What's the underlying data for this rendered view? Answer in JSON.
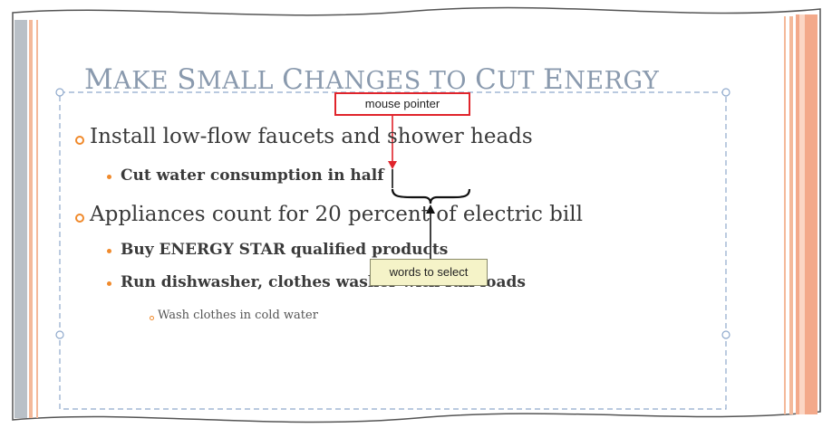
{
  "slide": {
    "title_parts": [
      {
        "cap": "M",
        "rest": "AKE "
      },
      {
        "cap": "S",
        "rest": "MALL "
      },
      {
        "cap": "C",
        "rest": "HANGES TO "
      },
      {
        "cap": "C",
        "rest": "UT "
      },
      {
        "cap": "E",
        "rest": "NERGY"
      }
    ],
    "bullet1": "Install low-flow faucets and shower heads",
    "bullet1_sub": "Cut water consumption in half",
    "bullet2": "Appliances count for 20 percent of electric bill",
    "bullet2_sub1": "Buy ENERGY STAR qualified products",
    "bullet2_sub2": "Run dishwasher, clothes washer with full loads",
    "bullet2_sub2_sub": "Wash clothes in cold water"
  },
  "callouts": {
    "mouse_pointer": "mouse pointer",
    "words_to_select": "words to select"
  },
  "colors": {
    "accent": "#f08a2c",
    "title": "#8a9aae",
    "callout_red": "#e0242b",
    "callout_yellow_bg": "#f5f3c8",
    "placeholder_border": "#8fa9cc"
  }
}
